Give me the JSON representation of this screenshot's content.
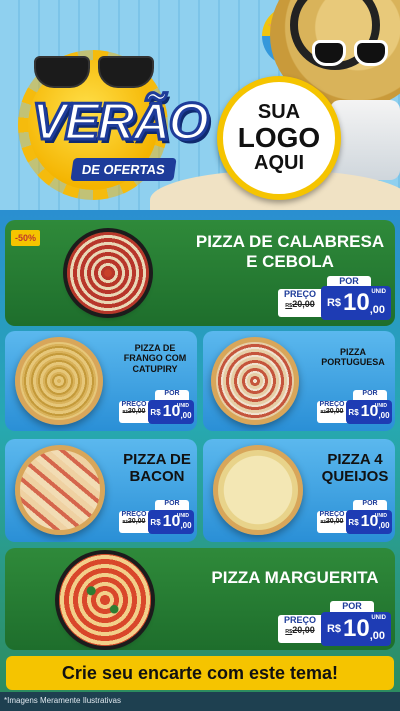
{
  "header": {
    "title": "VERÃO",
    "subtitle": "DE OFERTAS",
    "logo_lines": [
      "SUA",
      "LOGO",
      "AQUI"
    ]
  },
  "products": [
    {
      "name_line1": "PIZZA DE CALABRESA",
      "name_line2": "E CEBOLA",
      "badge": "-50%",
      "por": "POR",
      "preco_label": "PREÇO",
      "old_currency": "R$",
      "old_price": "20,00",
      "currency": "R$",
      "price_int": "10",
      "price_cents": ",00",
      "unit": "UNID"
    },
    {
      "name_line1": "PIZZA DE",
      "name_line2": "FRANGO COM",
      "name_line3": "CATUPIRY",
      "por": "POR",
      "preco_label": "PREÇO",
      "old_currency": "R$",
      "old_price": "20,00",
      "currency": "R$",
      "price_int": "10",
      "price_cents": ",00",
      "unit": "UNID"
    },
    {
      "name_line1": "PIZZA",
      "name_line2": "PORTUGUESA",
      "por": "POR",
      "preco_label": "PREÇO",
      "old_currency": "R$",
      "old_price": "20,00",
      "currency": "R$",
      "price_int": "10",
      "price_cents": ",00",
      "unit": "UNID"
    },
    {
      "name_line1": "PIZZA DE",
      "name_line2": "BACON",
      "por": "POR",
      "preco_label": "PREÇO",
      "old_currency": "R$",
      "old_price": "20,00",
      "currency": "R$",
      "price_int": "10",
      "price_cents": ",00",
      "unit": "UNID"
    },
    {
      "name_line1": "PIZZA 4",
      "name_line2": "QUEIJOS",
      "por": "POR",
      "preco_label": "PREÇO",
      "old_currency": "R$",
      "old_price": "20,00",
      "currency": "R$",
      "price_int": "10",
      "price_cents": ",00",
      "unit": "UNID"
    },
    {
      "name_line1": "PIZZA MARGUERITA",
      "por": "POR",
      "preco_label": "PREÇO",
      "old_currency": "R$",
      "old_price": "20,00",
      "currency": "R$",
      "price_int": "10",
      "price_cents": ",00",
      "unit": "UNID"
    }
  ],
  "footer": {
    "cta": "Crie seu encarte com este tema!",
    "note": "*Imagens Meramente Ilustrativas"
  },
  "colors": {
    "green": "#2f8a3a",
    "blue": "#2a8fd6",
    "yellow": "#f5c400",
    "price_blue": "#1e3cb4"
  }
}
